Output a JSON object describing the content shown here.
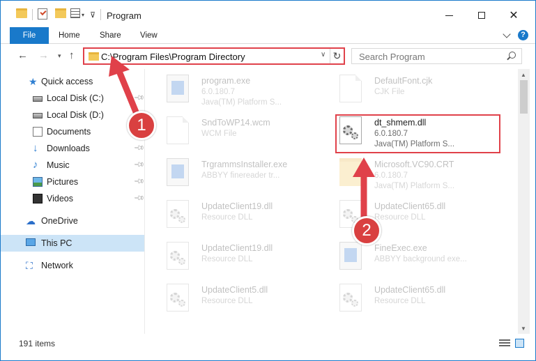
{
  "window": {
    "title": "Program",
    "accent": "#1979ca",
    "annotation_color": "#e0414a"
  },
  "ribbon": {
    "tabs": [
      "File",
      "Home",
      "Share",
      "View"
    ]
  },
  "nav": {
    "address": "C:\\Program Files\\Program Directory",
    "search_placeholder": "Search Program"
  },
  "sidebar": {
    "items": [
      {
        "label": "Quick access",
        "icon": "star-icon"
      },
      {
        "label": "Local Disk (C:)",
        "icon": "disk-icon",
        "pinned": true
      },
      {
        "label": "Local Disk (D:)",
        "icon": "disk-icon"
      },
      {
        "label": "Documents",
        "icon": "documents-icon",
        "pinned": true
      },
      {
        "label": "Downloads",
        "icon": "downloads-icon",
        "pinned": true
      },
      {
        "label": "Music",
        "icon": "music-icon",
        "pinned": true
      },
      {
        "label": "Pictures",
        "icon": "pictures-icon",
        "pinned": true
      },
      {
        "label": "Videos",
        "icon": "videos-icon",
        "pinned": true
      },
      {
        "label": "OneDrive",
        "icon": "onedrive-icon"
      },
      {
        "label": "This PC",
        "icon": "this-pc-icon",
        "selected": true
      },
      {
        "label": "Network",
        "icon": "network-icon"
      }
    ]
  },
  "files": [
    {
      "name": "program.exe",
      "line1": "6.0.180.7",
      "line2": "Java(TM) Platform S...",
      "icon": "exe-icon",
      "faded": true
    },
    {
      "name": "DefaultFont.cjk",
      "line1": "CJK File",
      "line2": "",
      "icon": "document-icon",
      "faded": true
    },
    {
      "name": "SndToWP14.wcm",
      "line1": "WCM File",
      "line2": "",
      "icon": "document-icon",
      "faded": true
    },
    {
      "name": "dt_shmem.dll",
      "line1": "6.0.180.7",
      "line2": "Java(TM) Platform S...",
      "icon": "dll-icon",
      "faded": false
    },
    {
      "name": "TrgrammsInstaller.exe",
      "line1": "ABBYY finereader tr...",
      "line2": "",
      "icon": "exe-icon",
      "faded": true
    },
    {
      "name": "Microsoft.VC90.CRT",
      "line1": "6.0.180.7",
      "line2": "Java(TM) Platform S...",
      "icon": "folder-icon",
      "faded": true
    },
    {
      "name": "UpdateClient19.dll",
      "line1": "Resource DLL",
      "line2": "",
      "icon": "dll-icon",
      "faded": true
    },
    {
      "name": "UpdateClient65.dll",
      "line1": "Resource DLL",
      "line2": "",
      "icon": "dll-icon",
      "faded": true
    },
    {
      "name": "UpdateClient19.dll",
      "line1": "Resource DLL",
      "line2": "",
      "icon": "dll-icon",
      "faded": true
    },
    {
      "name": "FineExec.exe",
      "line1": "ABBYY background exe...",
      "line2": "",
      "icon": "exe-icon",
      "faded": true
    },
    {
      "name": "UpdateClient5.dll",
      "line1": "Resource DLL",
      "line2": "",
      "icon": "dll-icon",
      "faded": true
    },
    {
      "name": "UpdateClient65.dll",
      "line1": "Resource DLL",
      "line2": "",
      "icon": "dll-icon",
      "faded": true
    }
  ],
  "status": {
    "item_count": "191 items"
  },
  "annotations": {
    "step1": "1",
    "step2": "2"
  }
}
